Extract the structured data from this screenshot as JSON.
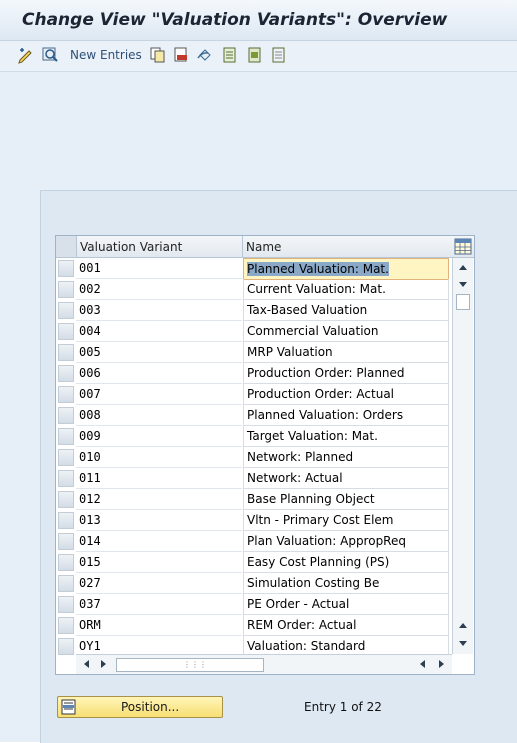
{
  "window": {
    "title": "Change View \"Valuation Variants\": Overview"
  },
  "toolbar": {
    "new_entries_label": "New Entries",
    "icons": [
      "display-change-icon",
      "other-view-icon",
      "copy-icon",
      "delete-icon",
      "undo-change-icon",
      "select-all-icon",
      "select-block-icon",
      "deselect-all-icon"
    ]
  },
  "table": {
    "columns": [
      "Valuation Variant",
      "Name"
    ],
    "rows": [
      {
        "variant": "001",
        "name": "Planned Valuation: Mat."
      },
      {
        "variant": "002",
        "name": "Current Valuation: Mat."
      },
      {
        "variant": "003",
        "name": "Tax-Based Valuation"
      },
      {
        "variant": "004",
        "name": "Commercial Valuation"
      },
      {
        "variant": "005",
        "name": "MRP Valuation"
      },
      {
        "variant": "006",
        "name": "Production Order: Planned"
      },
      {
        "variant": "007",
        "name": "Production Order: Actual"
      },
      {
        "variant": "008",
        "name": "Planned Valuation: Orders"
      },
      {
        "variant": "009",
        "name": "Target Valuation: Mat."
      },
      {
        "variant": "010",
        "name": "Network: Planned"
      },
      {
        "variant": "011",
        "name": "Network: Actual"
      },
      {
        "variant": "012",
        "name": "Base Planning Object"
      },
      {
        "variant": "013",
        "name": "Vltn - Primary Cost Elem"
      },
      {
        "variant": "014",
        "name": "Plan Valuation: AppropReq"
      },
      {
        "variant": "015",
        "name": "Easy Cost Planning (PS)"
      },
      {
        "variant": "027",
        "name": "Simulation Costing Be"
      },
      {
        "variant": "037",
        "name": "PE Order - Actual"
      },
      {
        "variant": "ORM",
        "name": "REM Order: Actual"
      },
      {
        "variant": "OY1",
        "name": "Valuation: Standard"
      }
    ],
    "active_row": 0
  },
  "footer": {
    "position_label": "Position...",
    "entry_text": "Entry 1 of 22"
  },
  "colors": {
    "accent": "#2e4f78",
    "button": "#f7df73",
    "selection": "#8aa9c9"
  }
}
